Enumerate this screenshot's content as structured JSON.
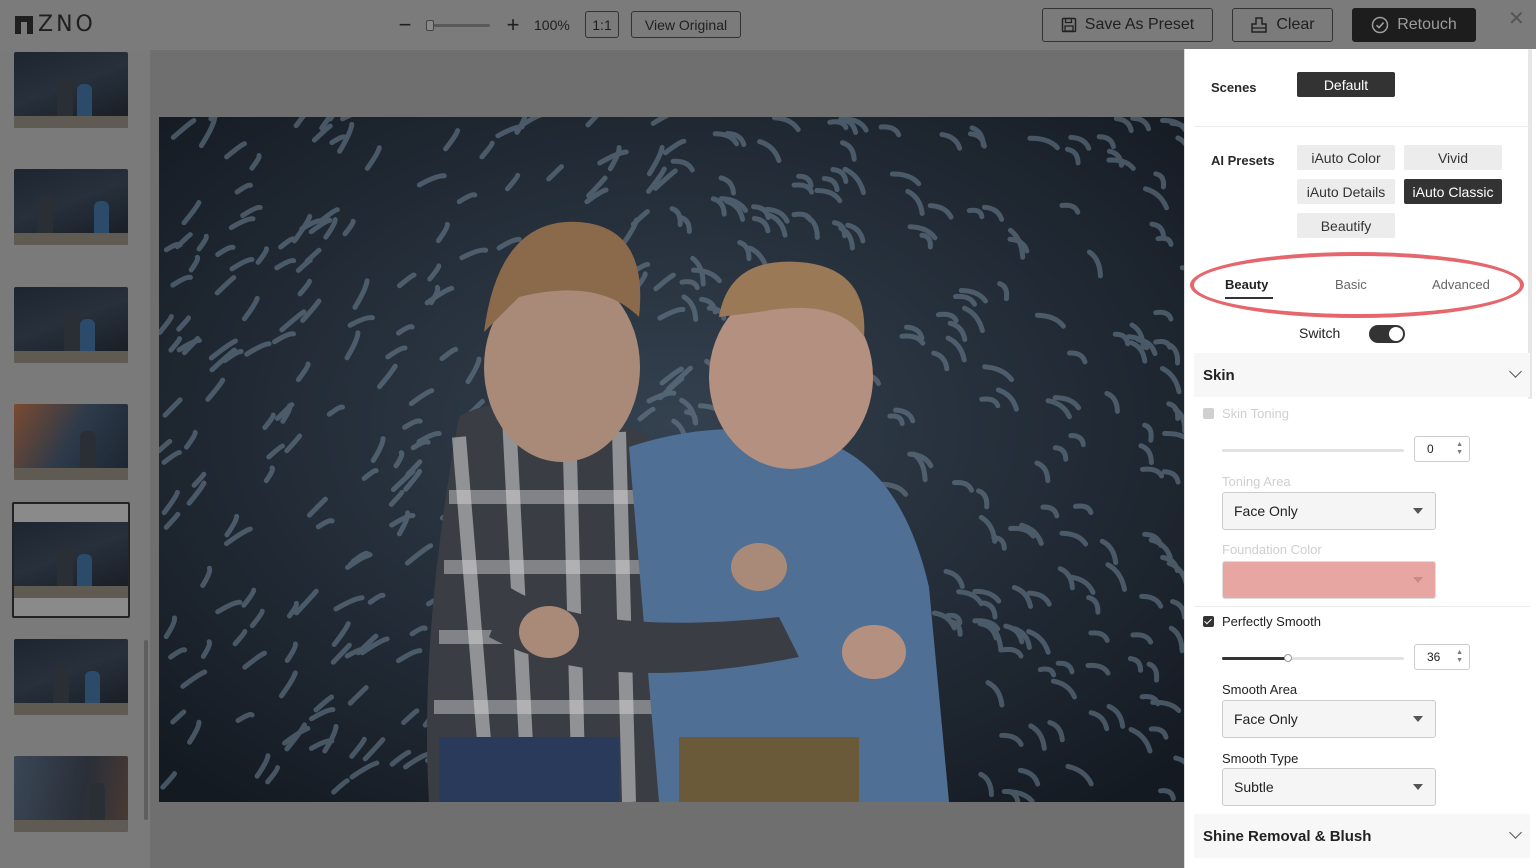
{
  "app": {
    "logo_text": "ZNO"
  },
  "toolbar": {
    "zoom_value": "100%",
    "one_to_one": "1:1",
    "view_original": "View Original",
    "save_as_preset": "Save As Preset",
    "clear": "Clear",
    "retouch": "Retouch"
  },
  "filmstrip": {
    "selected_index": 4,
    "thumb_count": 7
  },
  "panel": {
    "scenes_label": "Scenes",
    "scene_default": "Default",
    "ai_presets_label": "AI Presets",
    "presets": [
      "iAuto Color",
      "Vivid",
      "iAuto Details",
      "iAuto Classic",
      "Beautify"
    ],
    "active_preset": "iAuto Classic",
    "tabs": [
      "Beauty",
      "Basic",
      "Advanced"
    ],
    "active_tab": "Beauty",
    "switch_label": "Switch",
    "switch_on": true,
    "skin": {
      "title": "Skin",
      "skin_toning_label": "Skin Toning",
      "skin_toning_value": "0",
      "toning_area_label": "Toning Area",
      "toning_area_value": "Face Only",
      "foundation_color_label": "Foundation Color",
      "foundation_color": "#e8a6a2",
      "perfectly_smooth_label": "Perfectly Smooth",
      "perfectly_smooth_checked": true,
      "smooth_value": "36",
      "smooth_fraction": 0.36,
      "smooth_area_label": "Smooth Area",
      "smooth_area_value": "Face Only",
      "smooth_type_label": "Smooth Type",
      "smooth_type_value": "Subtle"
    },
    "shine_title": "Shine Removal & Blush"
  }
}
